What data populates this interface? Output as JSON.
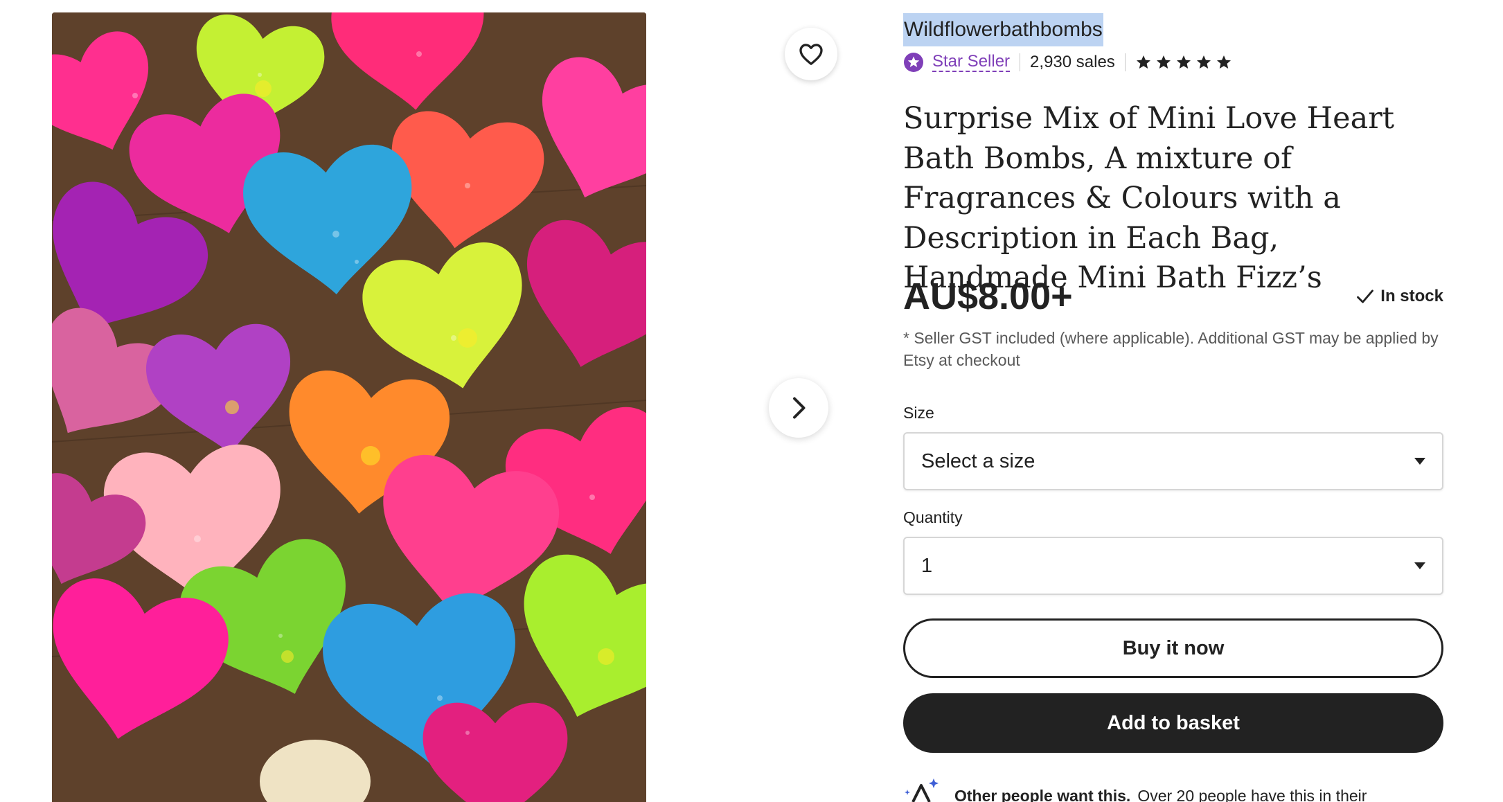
{
  "gallery": {
    "image_alt": "Colourful mini heart-shaped bath bombs on a wooden board",
    "favorite_icon": "heart-outline-icon",
    "next_icon": "chevron-right-icon"
  },
  "listing": {
    "shop_name": "Wildflowerbathbombs",
    "star_seller_label": "Star Seller",
    "sales": "2,930 sales",
    "rating_stars": 5,
    "title": "Surprise Mix of Mini Love Heart Bath Bombs, A mixture of Fragrances & Colours with a Description in Each Bag, Handmade Mini Bath Fizz’s",
    "price": "AU$8.00+",
    "stock": "In stock",
    "gst_note": "* Seller GST included (where applicable). Additional GST may be applied by Etsy at checkout"
  },
  "form": {
    "size_label": "Size",
    "size_value": "Select a size",
    "quantity_label": "Quantity",
    "quantity_value": "1"
  },
  "actions": {
    "buy_now": "Buy it now",
    "add_to_basket": "Add to basket"
  },
  "demand": {
    "strong": "Other people want this.",
    "text": "Over 20 people have this in their"
  },
  "colors": {
    "accent_purple": "#7f3fb8",
    "selection_highlight": "#bcd3f2",
    "button_dark": "#222222"
  }
}
